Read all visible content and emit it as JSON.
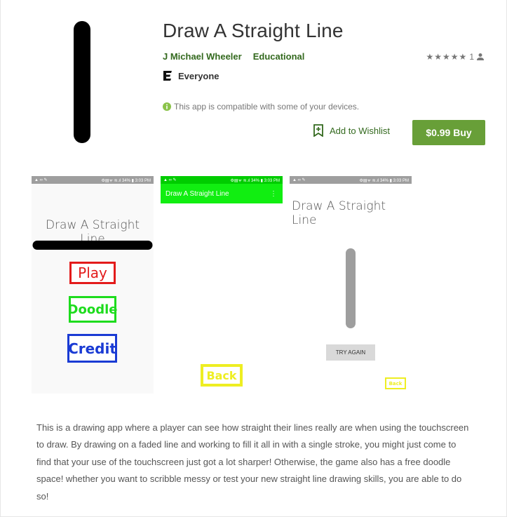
{
  "app": {
    "title": "Draw A Straight Line",
    "developer": "J Michael Wheeler",
    "category": "Educational",
    "rating_stars": "★★★★★",
    "rating_count": "1",
    "content_rating": "Everyone",
    "compatibility": "This app is compatible with some of your devices.",
    "wishlist_label": "Add to Wishlist",
    "buy_label": "$0.99 Buy",
    "accent_color": "#33691e",
    "buy_color": "#689f38"
  },
  "screenshots": {
    "status_left": "▲ ∞ ✎",
    "status_right": "⚙▤ᯤ ≋.ıl 34% ▮ 3:03 PM",
    "menu": {
      "title": "Draw A Straight Line",
      "play": "Play",
      "doodle": "Doodle",
      "credit": "Credit"
    },
    "doodle": {
      "toolbar_title": "Draw A Straight Line",
      "overflow_icon": "⋮",
      "back": "Back"
    },
    "play": {
      "title": "Draw A Straight Line",
      "try_again": "TRY AGAIN",
      "back": "Back"
    }
  },
  "description": "This is a drawing app where a player can see how straight their lines really are when using the touchscreen to draw. By drawing on a faded line and working to fill it all in with a single stroke, you might just come to find that your use of the touchscreen just got a lot sharper! Otherwise, the game also has a free doodle space! whether you want to scribble messy or test your new straight line drawing skills, you are able to do so!"
}
